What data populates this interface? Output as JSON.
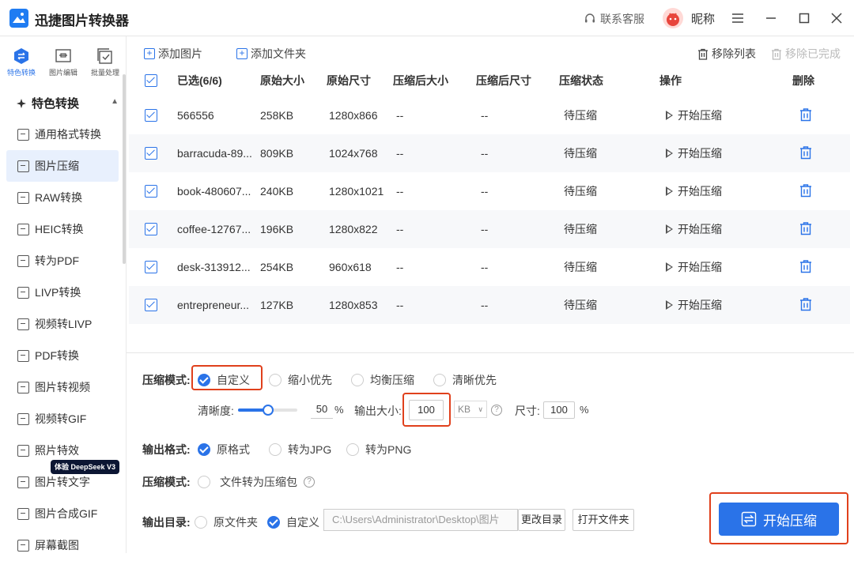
{
  "app": {
    "title": "迅捷图片转换器"
  },
  "header": {
    "support_label": "联系客服",
    "nickname": "昵称"
  },
  "sidebar": {
    "top_nav": [
      {
        "label": "特色转换",
        "icon": "feature-convert-icon",
        "active": true
      },
      {
        "label": "图片编辑",
        "icon": "image-edit-icon",
        "active": false
      },
      {
        "label": "批量处理",
        "icon": "batch-process-icon",
        "active": false
      }
    ],
    "group_title": "特色转换",
    "items": [
      {
        "label": "通用格式转换"
      },
      {
        "label": "图片压缩",
        "active": true
      },
      {
        "label": "RAW转换"
      },
      {
        "label": "HEIC转换"
      },
      {
        "label": "转为PDF"
      },
      {
        "label": "LIVP转换"
      },
      {
        "label": "视频转LIVP"
      },
      {
        "label": "PDF转换"
      },
      {
        "label": "图片转视频"
      },
      {
        "label": "视频转GIF"
      },
      {
        "label": "照片特效"
      },
      {
        "label": "图片转文字"
      },
      {
        "label": "图片合成GIF"
      },
      {
        "label": "屏幕截图"
      }
    ],
    "badge": "体验 DeepSeek V3"
  },
  "toolbar": {
    "add_image": "添加图片",
    "add_folder": "添加文件夹",
    "remove_list": "移除列表",
    "remove_done": "移除已完成"
  },
  "table": {
    "headers": {
      "selected": "已选(6/6)",
      "orig_size": "原始大小",
      "orig_dim": "原始尺寸",
      "comp_size": "压缩后大小",
      "comp_dim": "压缩后尺寸",
      "status": "压缩状态",
      "action": "操作",
      "delete": "删除"
    },
    "rows": [
      {
        "name": "566556",
        "size": "258KB",
        "dim": "1280x866",
        "csize": "--",
        "cdim": "--",
        "status": "待压缩",
        "action": "开始压缩"
      },
      {
        "name": "barracuda-89...",
        "size": "809KB",
        "dim": "1024x768",
        "csize": "--",
        "cdim": "--",
        "status": "待压缩",
        "action": "开始压缩"
      },
      {
        "name": "book-480607...",
        "size": "240KB",
        "dim": "1280x1021",
        "csize": "--",
        "cdim": "--",
        "status": "待压缩",
        "action": "开始压缩"
      },
      {
        "name": "coffee-12767...",
        "size": "196KB",
        "dim": "1280x822",
        "csize": "--",
        "cdim": "--",
        "status": "待压缩",
        "action": "开始压缩"
      },
      {
        "name": "desk-313912...",
        "size": "254KB",
        "dim": "960x618",
        "csize": "--",
        "cdim": "--",
        "status": "待压缩",
        "action": "开始压缩"
      },
      {
        "name": "entrepreneur...",
        "size": "127KB",
        "dim": "1280x853",
        "csize": "--",
        "cdim": "--",
        "status": "待压缩",
        "action": "开始压缩"
      }
    ]
  },
  "settings": {
    "mode_label": "压缩模式:",
    "modes": [
      "自定义",
      "缩小优先",
      "均衡压缩",
      "清晰优先"
    ],
    "clarity_label": "清晰度:",
    "clarity_value": "50",
    "clarity_fraction": 0.5,
    "percent": "%",
    "output_size_label": "输出大小:",
    "output_size_value": "100",
    "size_unit": "KB",
    "dim_label": "尺寸:",
    "dim_value": "100",
    "format_label": "输出格式:",
    "formats": [
      "原格式",
      "转为JPG",
      "转为PNG"
    ],
    "zip_label": "压缩模式:",
    "zip_option": "文件转为压缩包",
    "dir_label": "输出目录:",
    "dir_options": [
      "原文件夹",
      "自定义"
    ],
    "dir_path": "C:\\Users\\Administrator\\Desktop\\图片",
    "change_dir": "更改目录",
    "open_folder": "打开文件夹",
    "start": "开始压缩"
  },
  "colors": {
    "accent": "#2a73e8",
    "highlight": "#e0401c"
  }
}
